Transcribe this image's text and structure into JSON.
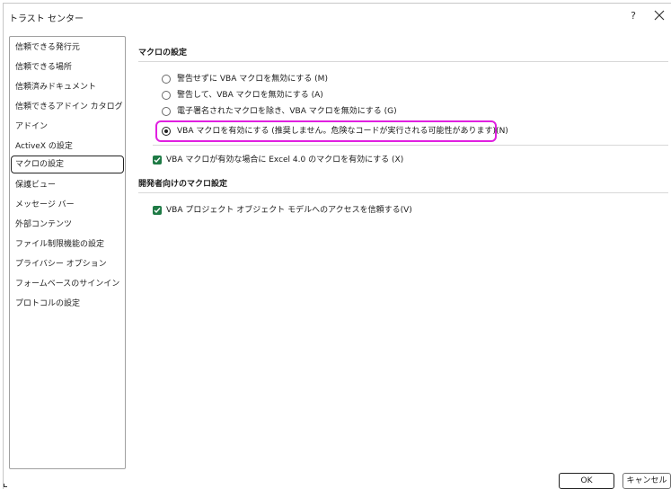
{
  "window": {
    "title": "トラスト センター",
    "help_label": "?",
    "close_icon": "close-icon"
  },
  "sidebar": {
    "items": [
      {
        "label": "信頼できる発行元"
      },
      {
        "label": "信頼できる場所"
      },
      {
        "label": "信頼済みドキュメント"
      },
      {
        "label": "信頼できるアドイン カタログ"
      },
      {
        "label": "アドイン"
      },
      {
        "label": "ActiveX の設定"
      },
      {
        "label": "マクロの設定",
        "selected": true
      },
      {
        "label": "保護ビュー"
      },
      {
        "label": "メッセージ バー"
      },
      {
        "label": "外部コンテンツ"
      },
      {
        "label": "ファイル制限機能の設定"
      },
      {
        "label": "プライバシー オプション"
      },
      {
        "label": "フォームベースのサインイン"
      },
      {
        "label": "プロトコルの設定"
      }
    ]
  },
  "macro_settings": {
    "heading": "マクロの設定",
    "options": [
      {
        "label": "警告せずに VBA マクロを無効にする (M)",
        "checked": false
      },
      {
        "label": "警告して、VBA マクロを無効にする (A)",
        "checked": false
      },
      {
        "label": "電子署名されたマクロを除き、VBA マクロを無効にする (G)",
        "checked": false
      },
      {
        "label": "VBA マクロを有効にする (推奨しません。危険なコードが実行される可能性があります)(N)",
        "checked": true
      }
    ],
    "excel4_checkbox": {
      "label": "VBA マクロが有効な場合に Excel 4.0 のマクロを有効にする (X)",
      "checked": true
    }
  },
  "developer_settings": {
    "heading": "開発者向けのマクロ設定",
    "vba_access_checkbox": {
      "label": "VBA プロジェクト オブジェクト モデルへのアクセスを信頼する(V)",
      "checked": true
    }
  },
  "footer": {
    "ok_label": "OK",
    "cancel_label": "キャンセル"
  },
  "colors": {
    "highlight": "#e020e0",
    "checkbox": "#1e7a45"
  }
}
